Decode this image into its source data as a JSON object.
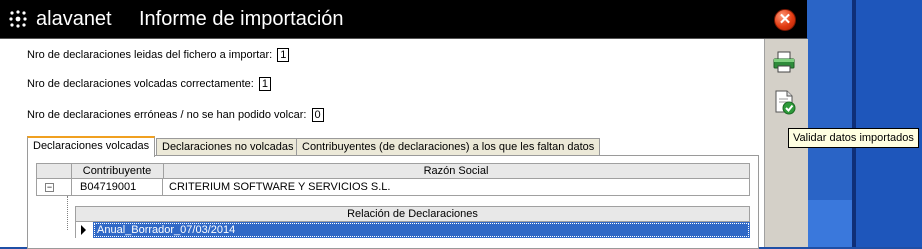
{
  "window": {
    "logo_text": "alavanet",
    "title": "Informe de importación",
    "close_icon": "close-icon"
  },
  "stats": [
    {
      "label": "Nro de declaraciones leidas del fichero a importar:",
      "value": "1"
    },
    {
      "label": "Nro de declaraciones volcadas correctamente:",
      "value": "1"
    },
    {
      "label": "Nro de declaraciones erróneas / no se han podido volcar:",
      "value": "0"
    }
  ],
  "tabs": [
    {
      "label": "Declaraciones volcadas",
      "active": true
    },
    {
      "label": "Declaraciones no volcadas",
      "active": false
    },
    {
      "label": "Contribuyentes (de declaraciones) a los que les faltan datos",
      "active": false
    }
  ],
  "grid": {
    "columns": [
      "Contribuyente",
      "Razón Social"
    ],
    "rows": [
      {
        "expander": "−",
        "contribuyente": "B04719001",
        "razon_social": "CRITERIUM SOFTWARE Y SERVICIOS S.L."
      }
    ],
    "sub_header": "Relación de Declaraciones",
    "sub_rows": [
      "Anual_Borrador_07/03/2014"
    ]
  },
  "side_icons": [
    "printer-icon",
    "validate-document-icon"
  ],
  "tooltip": "Validar datos importados",
  "colors": {
    "title_bg": "#000000",
    "selection": "#3169c6",
    "active_tab_accent": "#f0a020",
    "tooltip_bg": "#ffffe1"
  }
}
